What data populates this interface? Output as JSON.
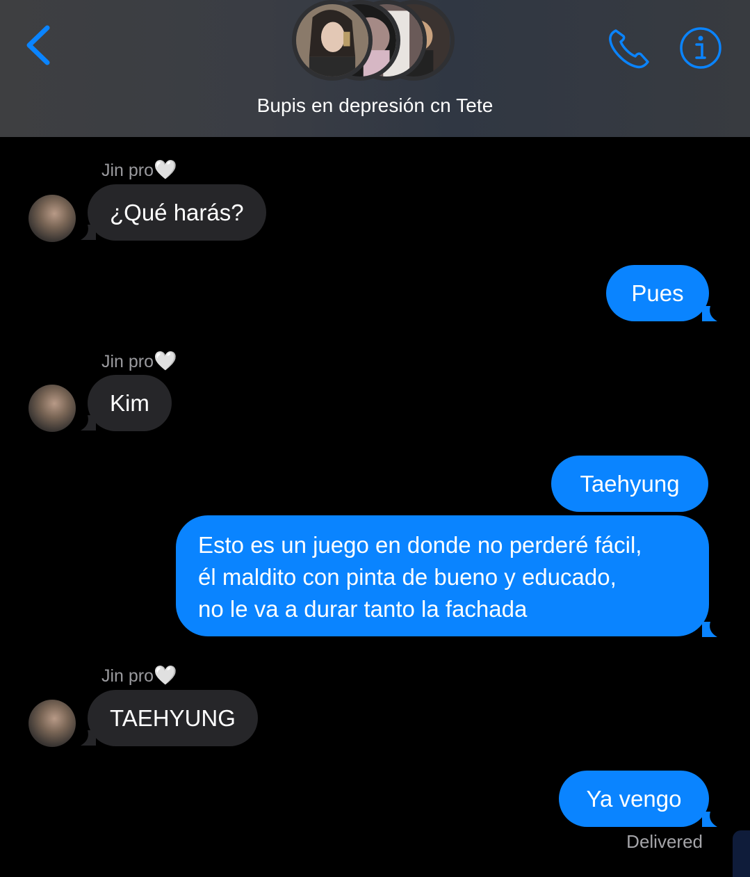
{
  "header": {
    "group_name": "Bupis en depresión cn Tete",
    "back_icon": "chevron-left-icon",
    "call_icon": "phone-icon",
    "info_icon": "info-icon",
    "accent_color": "#0a84ff"
  },
  "messages": [
    {
      "from": "Jin pro",
      "sender_suffix": "🤍",
      "text": "¿Qué harás?",
      "direction": "incoming"
    },
    {
      "text": "Pues",
      "direction": "outgoing"
    },
    {
      "from": "Jin pro",
      "sender_suffix": "🤍",
      "text": "Kim",
      "direction": "incoming"
    },
    {
      "text": "Taehyung",
      "direction": "outgoing"
    },
    {
      "lines": [
        "Esto es un juego en donde no perderé fácil,",
        "él maldito con pinta de bueno y educado,",
        "no le va a durar tanto la fachada"
      ],
      "direction": "outgoing"
    },
    {
      "from": "Jin pro",
      "sender_suffix": "🤍",
      "text": "TAEHYUNG",
      "direction": "incoming"
    },
    {
      "text": "Ya vengo",
      "direction": "outgoing"
    }
  ],
  "status": {
    "delivered_label": "Delivered"
  },
  "colors": {
    "incoming_bubble": "#262629",
    "outgoing_bubble": "#0a84ff",
    "background": "#000000"
  }
}
